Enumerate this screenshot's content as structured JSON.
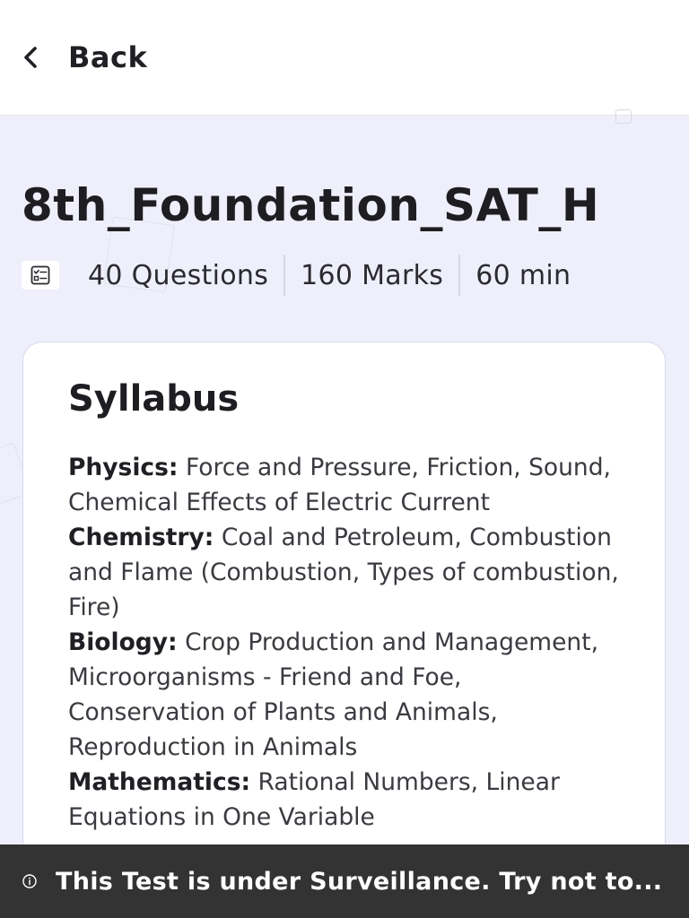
{
  "header": {
    "back_label": "Back",
    "back_icon": "chevron-left-icon"
  },
  "test": {
    "title": "8th_Foundation_SAT_H",
    "meta_icon": "checklist-icon",
    "questions": "40 Questions",
    "marks": "160 Marks",
    "duration": "60 min"
  },
  "syllabus": {
    "title": "Syllabus",
    "items": [
      {
        "subject": "Physics:",
        "topics": "Force and Pressure, Friction, Sound, Chemical Effects of Electric Current"
      },
      {
        "subject": "Chemistry:",
        "topics": "Coal and Petroleum, Combustion and Flame (Combustion, Types of combustion, Fire)"
      },
      {
        "subject": "Biology:",
        "topics": "Crop Production and Management, Microorganisms - Friend and Foe, Conservation of Plants and Animals, Reproduction in Animals"
      },
      {
        "subject": "Mathematics:",
        "topics": "Rational Numbers, Linear Equations in One Variable"
      }
    ]
  },
  "toast": {
    "icon": "info-icon",
    "text": "This Test is under Surveillance. Try not to..."
  },
  "colors": {
    "page_background": "#efeffb",
    "card_background": "#ffffff",
    "toast_background": "#333333",
    "text_primary": "#1f1f24"
  }
}
